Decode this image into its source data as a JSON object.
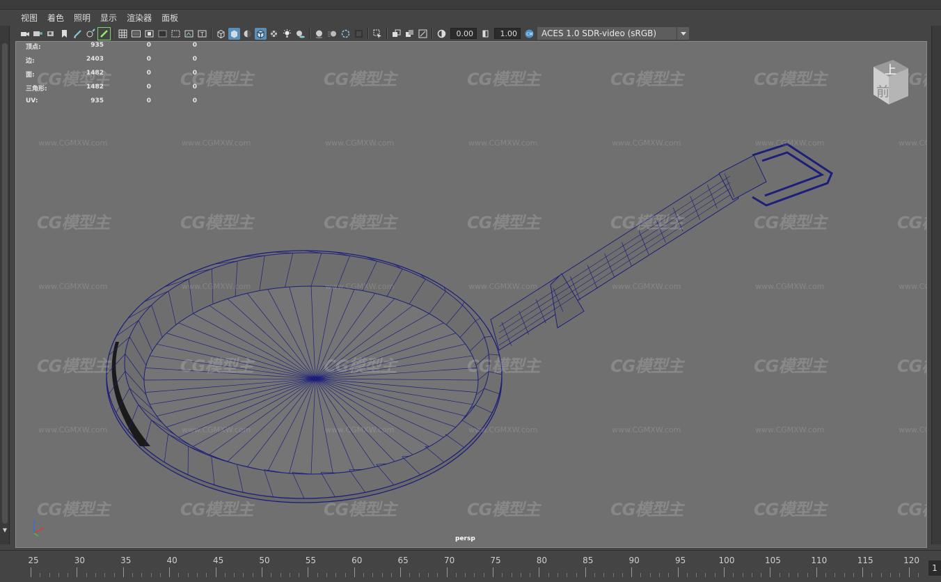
{
  "menu": [
    "视图",
    "着色",
    "照明",
    "显示",
    "渲染器",
    "面板"
  ],
  "toolbar": {
    "exposure_value": "0.00",
    "gamma_value": "1.00",
    "color_space": "ACES 1.0 SDR-video (sRGB)"
  },
  "hud": {
    "rows": [
      {
        "label": "顶点:",
        "v1": "935",
        "v2": "0",
        "v3": "0"
      },
      {
        "label": "边:",
        "v1": "2403",
        "v2": "0",
        "v3": "0"
      },
      {
        "label": "面:",
        "v1": "1482",
        "v2": "0",
        "v3": "0"
      },
      {
        "label": "三角形:",
        "v1": "1482",
        "v2": "0",
        "v3": "0"
      },
      {
        "label": "UV:",
        "v1": "935",
        "v2": "0",
        "v3": "0"
      }
    ]
  },
  "viewcube": {
    "top_label": "上",
    "front_label": "前"
  },
  "camera_label": "persp",
  "watermark": {
    "logo": "CG模型主",
    "url": "www.CGMXW.com"
  },
  "timeline": {
    "ticks": [
      "25",
      "30",
      "35",
      "40",
      "45",
      "50",
      "55",
      "60",
      "65",
      "70",
      "75",
      "80",
      "85",
      "90",
      "95",
      "100",
      "105",
      "110",
      "115",
      "120"
    ],
    "current_frame": "1"
  },
  "colors": {
    "viewport_bg": "#707070",
    "wire": "#1c1f7a",
    "ui_bg": "#444444",
    "accent": "#5a8fb8"
  }
}
